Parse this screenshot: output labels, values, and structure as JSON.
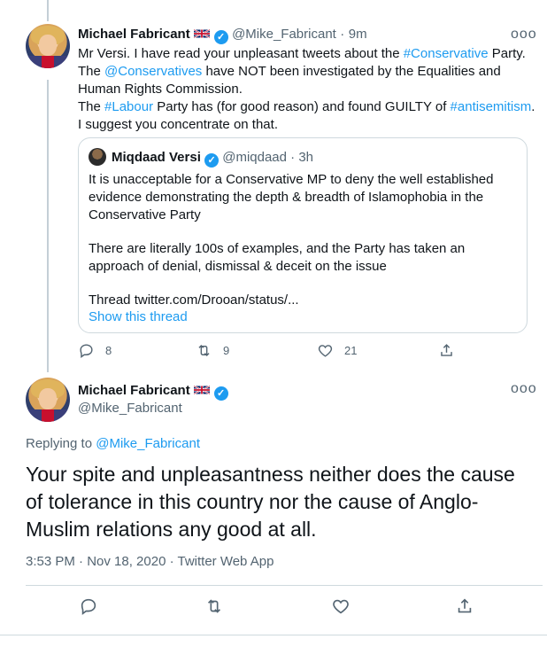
{
  "quoting_tweet": {
    "author_name": "Michael Fabricant",
    "author_handle": "@Mike_Fabricant",
    "separator": "·",
    "time": "9m",
    "lines": [
      [
        "Mr Versi.  I have read your unpleasant tweets about the ",
        "#Conservative",
        " Party."
      ],
      [
        "The ",
        "@Conservatives",
        " have NOT been investigated by the Equalities and"
      ],
      [
        "Human Rights Commission.",
        "",
        ""
      ],
      [
        "The ",
        "#Labour",
        " Party has (for good reason) and found GUILTY of "
      ],
      [
        "I suggest you concentrate on that.",
        "",
        ""
      ]
    ],
    "line4_link2": "#antisemitism",
    "line4_end": ".",
    "replies": "8",
    "retweets": "9",
    "likes": "21"
  },
  "quoted_tweet": {
    "author_name": "Miqdaad Versi",
    "author_handle": "@miqdaad",
    "separator": "·",
    "time": "3h",
    "para1": "It is unacceptable for a Conservative MP to deny the well established evidence demonstrating the depth & breadth of Islamophobia in the Conservative Party",
    "para2": "There are literally 100s of examples, and the Party has taken an approach of denial, dismissal & deceit on the issue",
    "para3": "Thread twitter.com/Drooan/status/...",
    "show_thread": "Show this thread"
  },
  "reply_tweet": {
    "author_name": "Michael Fabricant",
    "author_handle": "@Mike_Fabricant",
    "replying_to_label": "Replying to ",
    "replying_to_handle": "@Mike_Fabricant",
    "text": "Your spite and unpleasantness neither does the cause of tolerance in this country nor the cause of Anglo-Muslim relations any good at all.",
    "timestamp": "3:53 PM · Nov 18, 2020 · Twitter Web App"
  },
  "more_glyph": "ooo",
  "colors": {
    "accent": "#1d9bf0",
    "muted": "#536471",
    "border": "#cfd9de"
  }
}
